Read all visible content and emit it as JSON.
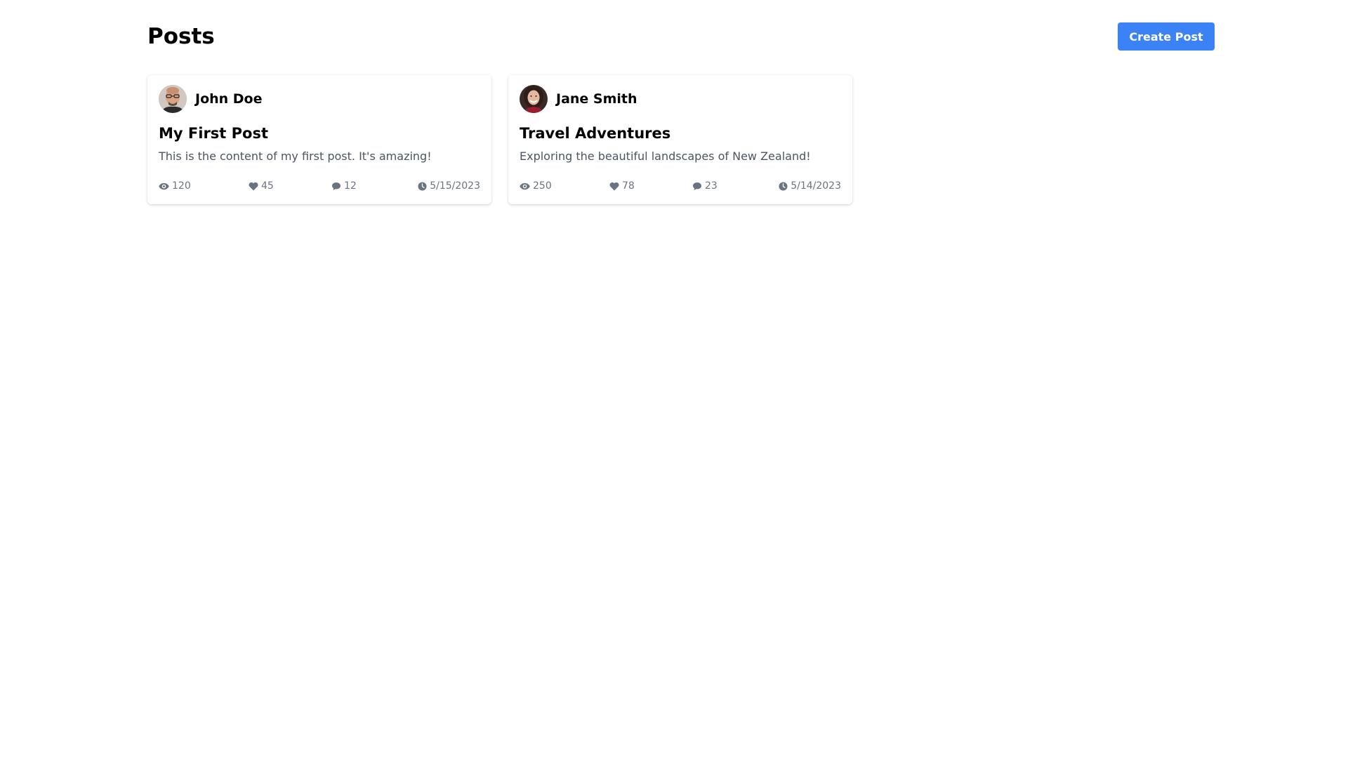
{
  "header": {
    "title": "Posts",
    "create_button_label": "Create Post"
  },
  "colors": {
    "primary": "#3b82f6",
    "muted_text": "#4b5563",
    "stat_text": "#6b7280"
  },
  "posts": [
    {
      "author": "John Doe",
      "title": "My First Post",
      "content": "This is the content of my first post. It's amazing!",
      "views": "120",
      "likes": "45",
      "comments": "12",
      "date": "5/15/2023"
    },
    {
      "author": "Jane Smith",
      "title": "Travel Adventures",
      "content": "Exploring the beautiful landscapes of New Zealand!",
      "views": "250",
      "likes": "78",
      "comments": "23",
      "date": "5/14/2023"
    }
  ],
  "icons": {
    "views": "eye-icon",
    "likes": "heart-icon",
    "comments": "comment-icon",
    "date": "clock-icon"
  }
}
